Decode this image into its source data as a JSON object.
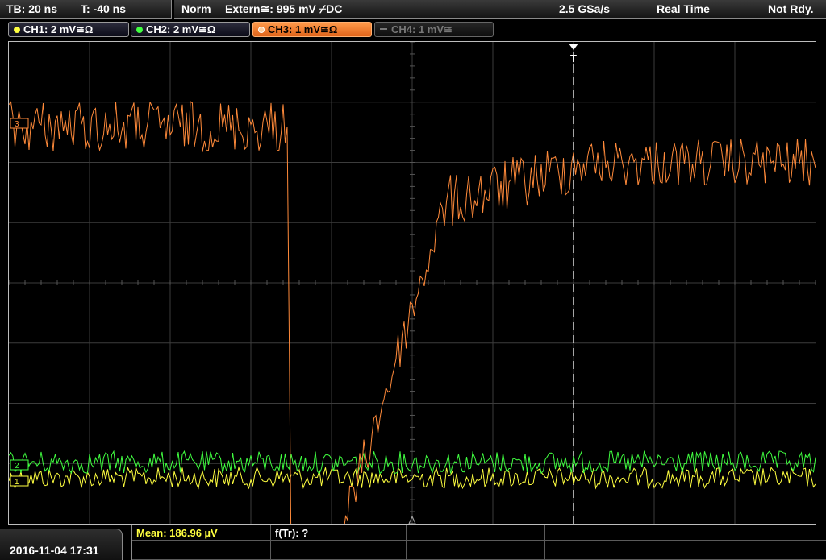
{
  "header": {
    "timebase": "TB: 20 ns",
    "trigger_pos": "T: -40 ns",
    "trigger_mode": "Norm",
    "trigger_source": "Extern≅: 995 mV ⌿DC",
    "sample_rate": "2.5 GSa/s",
    "acq_mode": "Real Time",
    "status": "Not Rdy."
  },
  "channels": [
    {
      "label": "CH1: 2 mV≅Ω",
      "color": "#ffff40",
      "state": "on"
    },
    {
      "label": "CH2: 2 mV≅Ω",
      "color": "#40ff40",
      "state": "on"
    },
    {
      "label": "CH3: 1 mV≅Ω",
      "color": "#ff8a3a",
      "state": "active"
    },
    {
      "label": "CH4: 1 mV≅",
      "color": "#777777",
      "state": "off"
    }
  ],
  "markers": {
    "trigger_label": "T",
    "ch3_ref": "3",
    "ch2_ref": "2",
    "ch1_ref": "1"
  },
  "footer": {
    "datetime": "2016-11-04 17:31",
    "meas1": "Mean: 186.96 µV",
    "meas2": "f(Tr): ?"
  },
  "colors": {
    "grid": "#3c3c3c",
    "ch1": "#ffff40",
    "ch2": "#40ff40",
    "ch3": "#ff8a3a"
  }
}
